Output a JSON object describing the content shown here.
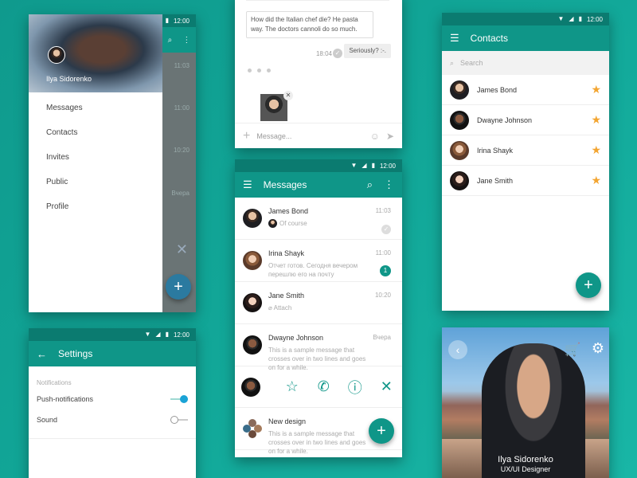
{
  "status": {
    "time": "12:00"
  },
  "drawer": {
    "user_name": "Ilya Sidorenko",
    "menu": [
      "Messages",
      "Contacts",
      "Invites",
      "Public",
      "Profile"
    ],
    "underlay_times": [
      "11:03",
      "11:00",
      "10:20"
    ],
    "underlay_snippet": "Вчера"
  },
  "chat": {
    "incoming_text": "How did the Italian chef die? He pasta way. The doctors cannoli do so much.",
    "outgoing_text": "Seriously? :-.",
    "outgoing_time": "18:04",
    "composer_placeholder": "Message..."
  },
  "messages": {
    "title": "Messages",
    "items": [
      {
        "name": "James Bond",
        "preview": "Of course",
        "time": "11:03",
        "status": "read"
      },
      {
        "name": "Irina Shayk",
        "preview": "Отчет готов. Сегодня вечером перешлю его на почту",
        "time": "11:00",
        "badge": "1"
      },
      {
        "name": "Jane Smith",
        "preview": "Attach",
        "time": "10:20"
      },
      {
        "name": "Dwayne  Johnson",
        "preview": "This is a sample message that crosses over in two lines and goes on for a while.",
        "time": "Вчера"
      },
      {
        "name": "New design",
        "preview": "This is a sample message that crosses over in two lines and goes on for a while."
      }
    ]
  },
  "contacts": {
    "title": "Contacts",
    "search_placeholder": "Search",
    "items": [
      "James Bond",
      "Dwayne  Johnson",
      "Irina Shayk",
      "Jane Smith"
    ]
  },
  "settings": {
    "title": "Settings",
    "section": "Notifications",
    "push_label": "Push-notifications",
    "push_on": true,
    "sound_label": "Sound",
    "sound_on": false
  },
  "profile": {
    "name": "Ilya Sidorenko",
    "role": "UX/UI Designer"
  },
  "colors": {
    "primary": "#0f9688",
    "primary_dark": "#0b7b70",
    "accent_star": "#f3a531",
    "switch_on": "#1aa3d6"
  },
  "icons": [
    "menu-icon",
    "search-icon",
    "more-icon",
    "back-arrow-icon",
    "plus-icon",
    "star-icon",
    "phone-icon",
    "info-icon",
    "close-icon",
    "send-icon",
    "smile-icon",
    "cart-icon",
    "gear-icon",
    "check-icon"
  ]
}
